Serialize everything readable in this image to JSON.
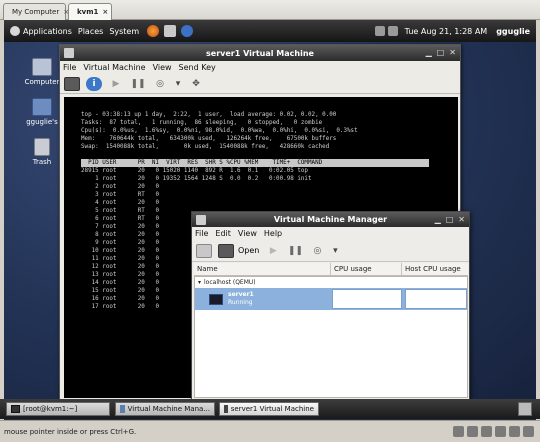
{
  "host_tabs": [
    {
      "label": "My Computer",
      "close": "×"
    },
    {
      "label": "kvm1",
      "close": "×"
    }
  ],
  "guest_panel": {
    "applications": "Applications",
    "places": "Places",
    "system": "System",
    "datetime": "Tue Aug 21,  1:28 AM",
    "user": "gguglie"
  },
  "desktop_icons": [
    {
      "label": "Computer"
    },
    {
      "label": "gguglie's"
    },
    {
      "label": "Trash"
    }
  ],
  "vm_window": {
    "title": "server1 Virtual Machine",
    "menu": [
      "File",
      "Virtual Machine",
      "View",
      "Send Key"
    ],
    "toolbar_icons": [
      "console-icon",
      "info-icon",
      "play-icon",
      "pause-icon",
      "power-icon",
      "dropdown-icon",
      "fullscreen-icon"
    ]
  },
  "terminal": {
    "summary": [
      "top - 03:38:13 up 1 day,  2:22,  1 user,  load average: 0.02, 0.02, 0.00",
      "Tasks:  87 total,   1 running,  86 sleeping,   0 stopped,   0 zombie",
      "Cpu(s):  0.0%us,  1.6%sy,  0.0%ni, 98.0%id,  0.0%wa,  0.0%hi,  0.0%si,  0.3%st",
      "Mem:    760644k total,   634300k used,   126264k free,    67500k buffers",
      "Swap:  1540088k total,       0k used,  1540088k free,   428660k cached"
    ],
    "header": "  PID USER      PR  NI  VIRT  RES  SHR S %CPU %MEM    TIME+  COMMAND",
    "rows": [
      "28915 root      20   0 15020 1140  892 R  1.6  0.1   0:02.05 top",
      "    1 root      20   0 19352 1564 1248 S  0.0  0.2   0:00.98 init",
      "    2 root      20   0",
      "    3 root      RT   0",
      "    4 root      20   0",
      "    5 root      RT   0",
      "    6 root      RT   0",
      "    7 root      20   0",
      "    8 root      20   0",
      "    9 root      20   0",
      "   10 root      20   0",
      "   11 root      20   0",
      "   12 root      20   0",
      "   13 root      20   0",
      "   14 root      20   0",
      "   15 root      20   0",
      "   16 root      20   0",
      "   17 root      20   0"
    ]
  },
  "vmm_window": {
    "title": "Virtual Machine Manager",
    "menu": [
      "File",
      "Edit",
      "View",
      "Help"
    ],
    "open_label": "Open",
    "columns": [
      "Name",
      "CPU usage",
      "Host CPU usage"
    ],
    "host_label": "localhost (QEMU)",
    "vm_name": "server1",
    "vm_status": "Running"
  },
  "taskbar": [
    {
      "label": "[root@kvm1:~]"
    },
    {
      "label": "Virtual Machine Mana..."
    },
    {
      "label": "server1 Virtual Machine"
    }
  ],
  "status_text": "mouse pointer inside or press Ctrl+G."
}
